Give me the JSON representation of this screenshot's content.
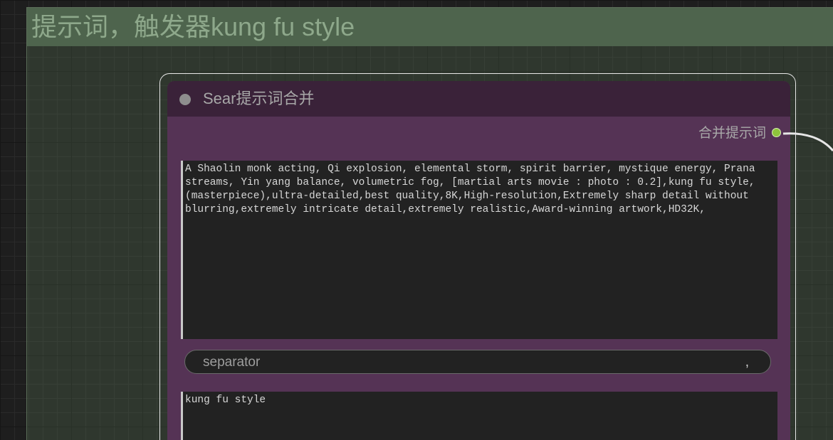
{
  "group": {
    "title": "提示词，触发器kung fu style"
  },
  "node": {
    "title": "Sear提示词合并",
    "output_label": "合并提示词",
    "prompt_text": "A Shaolin monk acting, Qi explosion, elemental storm, spirit barrier, mystique energy, Prana streams, Yin yang balance, volumetric fog, [martial arts movie : photo : 0.2],kung fu style,(masterpiece),ultra-detailed,best quality,8K,High-resolution,Extremely sharp detail without blurring,extremely intricate detail,extremely realistic,Award-winning artwork,HD32K,",
    "separator_label": "separator",
    "separator_value": ",",
    "second_text": "kung fu style"
  },
  "colors": {
    "group_header": "#4e644d",
    "node_body": "#553355",
    "node_title_bar": "#3a2239",
    "output_dot": "#8ec43c"
  },
  "icons": {
    "collapse": "circle-dot-icon",
    "output": "output-socket-icon"
  }
}
